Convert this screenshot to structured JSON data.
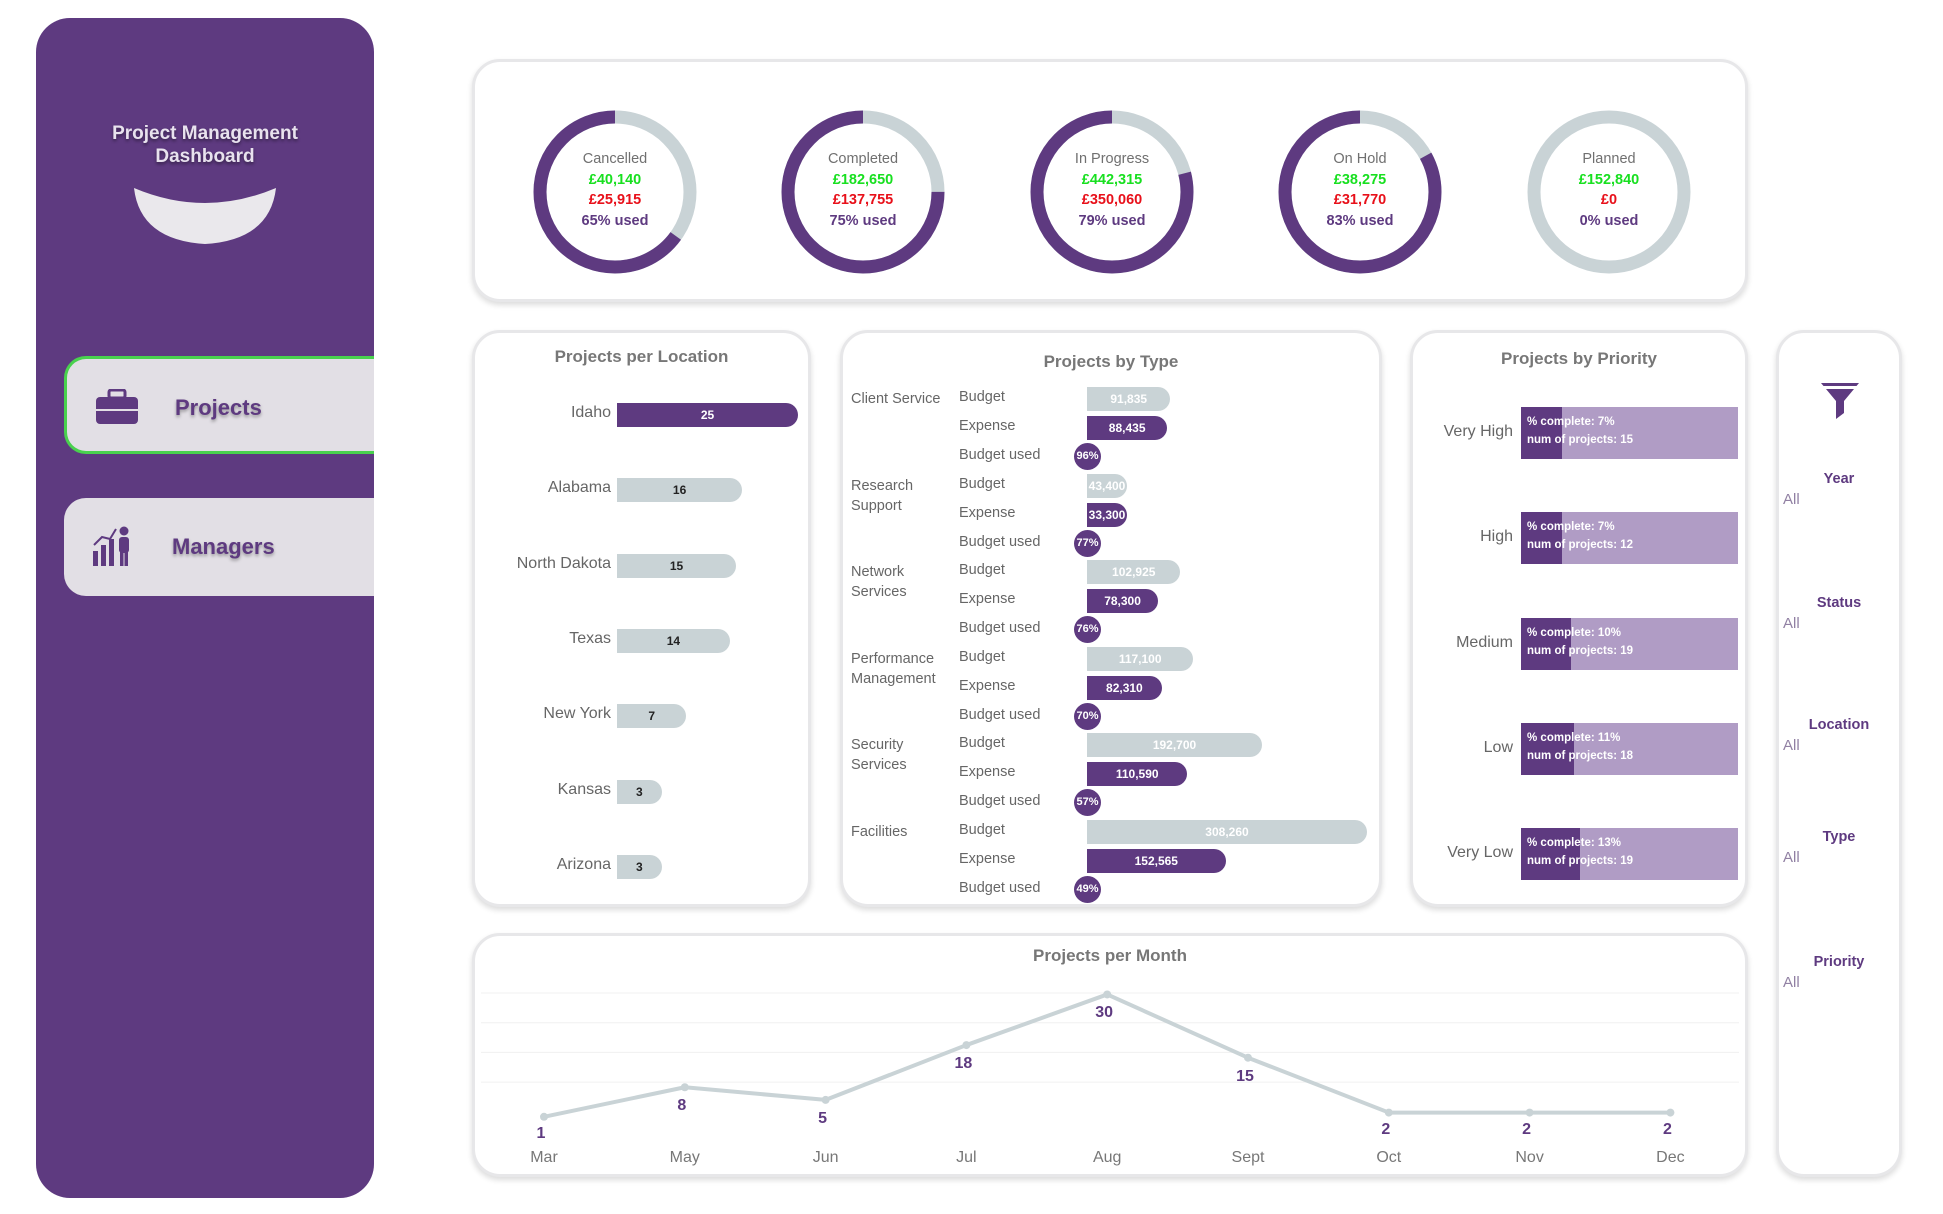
{
  "sidebar": {
    "title": "Project Management\nDashboard",
    "nav": [
      {
        "label": "Projects",
        "icon": "briefcase-icon",
        "active": true
      },
      {
        "label": "Managers",
        "icon": "chart-person-icon",
        "active": false
      }
    ]
  },
  "status_cards": [
    {
      "status": "Cancelled",
      "budget": "£40,140",
      "expense": "£25,915",
      "used_label": "65% used",
      "used": 0.65
    },
    {
      "status": "Completed",
      "budget": "£182,650",
      "expense": "£137,755",
      "used_label": "75% used",
      "used": 0.75
    },
    {
      "status": "In Progress",
      "budget": "£442,315",
      "expense": "£350,060",
      "used_label": "79% used",
      "used": 0.79
    },
    {
      "status": "On Hold",
      "budget": "£38,275",
      "expense": "£31,770",
      "used_label": "83% used",
      "used": 0.83
    },
    {
      "status": "Planned",
      "budget": "£152,840",
      "expense": "£0",
      "used_label": "0% used",
      "used": 0
    }
  ],
  "location": {
    "title": "Projects per Location",
    "items": [
      {
        "name": "Idaho",
        "count": 25
      },
      {
        "name": "Alabama",
        "count": 16
      },
      {
        "name": "North Dakota",
        "count": 15
      },
      {
        "name": "Texas",
        "count": 14
      },
      {
        "name": "New York",
        "count": 7
      },
      {
        "name": "Kansas",
        "count": 3
      },
      {
        "name": "Arizona",
        "count": 3
      }
    ]
  },
  "types": {
    "title": "Projects by Type",
    "row_labels": {
      "budget": "Budget",
      "expense": "Expense",
      "used": "Budget used"
    },
    "items": [
      {
        "name": "Client Service",
        "budget": 91835,
        "budget_label": "91,835",
        "expense": 88435,
        "expense_label": "88,435",
        "used_label": "96%"
      },
      {
        "name": "Research\nSupport",
        "budget": 43400,
        "budget_label": "43,400",
        "expense": 33300,
        "expense_label": "33,300",
        "used_label": "77%"
      },
      {
        "name": "Network\nServices",
        "budget": 102925,
        "budget_label": "102,925",
        "expense": 78300,
        "expense_label": "78,300",
        "used_label": "76%"
      },
      {
        "name": "Performance\nManagement",
        "budget": 117100,
        "budget_label": "117,100",
        "expense": 82310,
        "expense_label": "82,310",
        "used_label": "70%"
      },
      {
        "name": "Security\nServices",
        "budget": 192700,
        "budget_label": "192,700",
        "expense": 110590,
        "expense_label": "110,590",
        "used_label": "57%"
      },
      {
        "name": "Facilities",
        "budget": 308260,
        "budget_label": "308,260",
        "expense": 152565,
        "expense_label": "152,565",
        "used_label": "49%"
      }
    ]
  },
  "priority": {
    "title": "Projects by Priority",
    "items": [
      {
        "name": "Very High",
        "complete": 0.07,
        "complete_label": "% complete: 7%",
        "count_label": "num of projects: 15"
      },
      {
        "name": "High",
        "complete": 0.07,
        "complete_label": "% complete: 7%",
        "count_label": "num of projects: 12"
      },
      {
        "name": "Medium",
        "complete": 0.1,
        "complete_label": "% complete: 10%",
        "count_label": "num of projects: 19"
      },
      {
        "name": "Low",
        "complete": 0.11,
        "complete_label": "% complete: 11%",
        "count_label": "num of projects: 18"
      },
      {
        "name": "Very Low",
        "complete": 0.13,
        "complete_label": "% complete: 13%",
        "count_label": "num of projects: 19"
      }
    ]
  },
  "filters": {
    "icon": "funnel-icon",
    "items": [
      {
        "label": "Year",
        "value": "All"
      },
      {
        "label": "Status",
        "value": "All"
      },
      {
        "label": "Location",
        "value": "All"
      },
      {
        "label": "Type",
        "value": "All"
      },
      {
        "label": "Priority",
        "value": "All"
      }
    ]
  },
  "chart_data": {
    "type": "line",
    "title": "Projects per Month",
    "categories": [
      "Mar",
      "May",
      "Jun",
      "Jul",
      "Aug",
      "Sept",
      "Oct",
      "Nov",
      "Dec"
    ],
    "values": [
      1,
      8,
      5,
      18,
      30,
      15,
      2,
      2,
      2
    ],
    "ylim": [
      0,
      32
    ],
    "grid": true
  },
  "colors": {
    "purple": "#5e3a80",
    "light_purple": "#b09cc5",
    "grey_bar": "#c9d3d6",
    "budget_green": "#18e020",
    "expense_red": "#e8101a",
    "active_border": "#49d14e"
  }
}
